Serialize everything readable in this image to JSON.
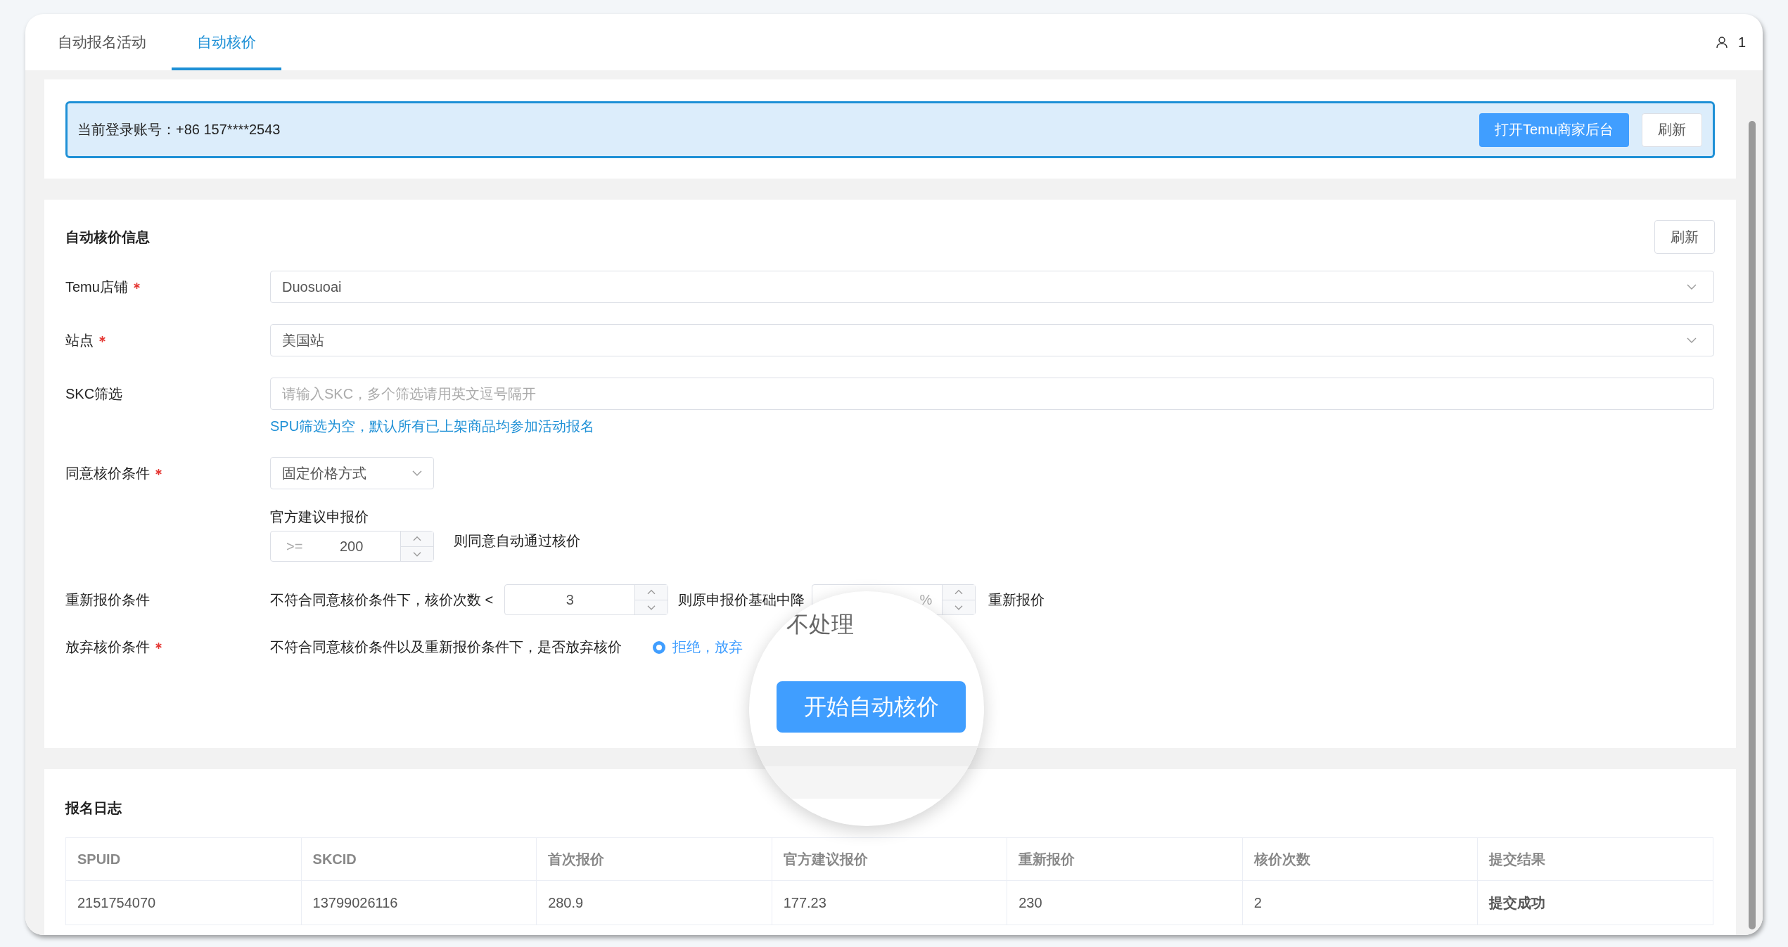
{
  "tabs": [
    {
      "label": "自动报名活动",
      "selected": false
    },
    {
      "label": "自动核价",
      "selected": true
    }
  ],
  "user": {
    "count": "1"
  },
  "account_bar": {
    "text": "当前登录账号：+86 157****2543",
    "buttons": [
      {
        "label": "打开Temu商家后台",
        "kind": "primary"
      },
      {
        "label": "刷新",
        "kind": "plain"
      }
    ]
  },
  "settings": {
    "title": "自动核价信息",
    "refresh_button": "刷新",
    "store": {
      "label": "Temu店铺",
      "required": true,
      "value": "Duosuoai"
    },
    "site": {
      "label": "站点",
      "required": true,
      "value": "美国站"
    },
    "skc_filter": {
      "label": "SKC筛选",
      "required": false,
      "placeholder": "请输入SKC，多个筛选请用英文逗号隔开",
      "hint": "SPU筛选为空，默认所有已上架商品均参加活动报名"
    },
    "agree_condition": {
      "label": "同意核价条件",
      "required": true,
      "mode": "固定价格方式",
      "sub_label": "官方建议申报价",
      "prefix": ">=",
      "value": "200",
      "suffix_text": "则同意自动通过核价"
    },
    "requote_condition": {
      "label": "重新报价条件",
      "required": false,
      "prefix_text": "不符合同意核价条件下，核价次数 <",
      "count": "3",
      "middle_text": "则原申报价基础中降",
      "unit": "%",
      "suffix_text": "重新报价"
    },
    "abandon_condition": {
      "label": "放弃核价条件",
      "required": true,
      "text": "不符合同意核价条件以及重新报价条件下，是否放弃核价",
      "options": [
        {
          "label": "拒绝，放弃",
          "selected": true
        }
      ]
    }
  },
  "magnifier": {
    "caption": "不处理",
    "button": "开始自动核价"
  },
  "log": {
    "title": "报名日志",
    "columns": [
      "SPUID",
      "SKCID",
      "首次报价",
      "官方建议报价",
      "重新报价",
      "核价次数",
      "提交结果"
    ],
    "rows": [
      [
        "2151754070",
        "13799026116",
        "280.9",
        "177.23",
        "230",
        "2",
        "提交成功"
      ]
    ]
  }
}
